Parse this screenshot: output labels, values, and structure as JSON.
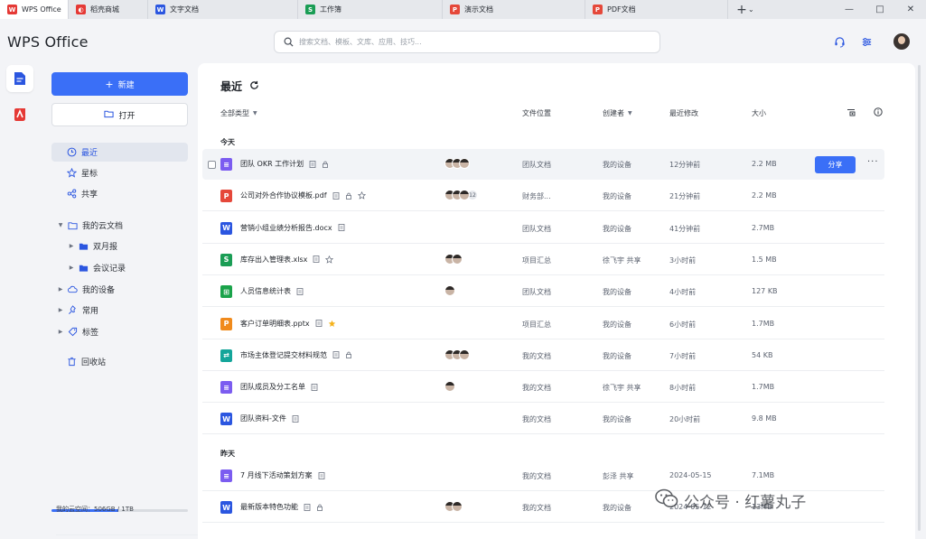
{
  "tabs": [
    {
      "label": "WPS Office",
      "icon": "wps-logo-icon",
      "color": "#e53935",
      "glyph": "W",
      "active": true,
      "width": 76
    },
    {
      "label": "稻壳商城",
      "icon": "docer-icon",
      "color": "#e53935",
      "glyph": "◐",
      "active": false,
      "width": 88
    },
    {
      "label": "文字文档",
      "icon": "writer-icon",
      "color": "#2b56e0",
      "glyph": "W",
      "active": false,
      "width": 166
    },
    {
      "label": "工作簿",
      "icon": "spreadsheet-icon",
      "color": "#1a9d55",
      "glyph": "S",
      "active": false,
      "width": 160
    },
    {
      "label": "演示文档",
      "icon": "presentation-icon",
      "color": "#e5483a",
      "glyph": "P",
      "active": false,
      "width": 158
    },
    {
      "label": "PDF文档",
      "icon": "pdf-icon",
      "color": "#e5483a",
      "glyph": "P",
      "active": false,
      "width": 158
    }
  ],
  "header": {
    "brand": "WPS Office",
    "search_placeholder": "搜索文档、模板、文库、应用、技巧..."
  },
  "sidebar": {
    "new_label": "新建",
    "open_label": "打开",
    "nav": [
      {
        "label": "最近",
        "icon": "clock-icon",
        "active": true,
        "indent": 0,
        "caret": ""
      },
      {
        "label": "星标",
        "icon": "star-icon",
        "active": false,
        "indent": 0,
        "caret": ""
      },
      {
        "label": "共享",
        "icon": "share-icon",
        "active": false,
        "indent": 0,
        "caret": ""
      },
      {
        "label": "我的云文档",
        "icon": "folder-outline-icon",
        "active": false,
        "indent": 0,
        "caret": "down"
      },
      {
        "label": "双月报",
        "icon": "folder-icon",
        "active": false,
        "indent": 1,
        "caret": "right"
      },
      {
        "label": "会议记录",
        "icon": "folder-icon",
        "active": false,
        "indent": 1,
        "caret": "right"
      },
      {
        "label": "我的设备",
        "icon": "cloud-icon",
        "active": false,
        "indent": 0,
        "caret": "right"
      },
      {
        "label": "常用",
        "icon": "pin-icon",
        "active": false,
        "indent": 0,
        "caret": "right"
      },
      {
        "label": "标签",
        "icon": "tag-icon",
        "active": false,
        "indent": 0,
        "caret": "right"
      },
      {
        "label": "回收站",
        "icon": "trash-icon",
        "active": false,
        "indent": 0,
        "caret": ""
      }
    ],
    "storage_label": "我的云空间：506GB / 1TB",
    "storage_upgrade": "查看",
    "storage_fraction": 0.49
  },
  "main": {
    "title": "最近",
    "columns": {
      "type": "全部类型",
      "location": "文件位置",
      "creator": "创建者",
      "modified": "最近修改",
      "size": "大小"
    },
    "groups": [
      {
        "label": "今天",
        "files": [
          {
            "name": "团队 OKR 工作计划",
            "type": "form",
            "collab": 3,
            "more": "",
            "star": false,
            "starred": false,
            "location": "团队文档",
            "creator": "我的设备",
            "modified": "12分钟前",
            "size": "2.2 MB",
            "hover": true
          },
          {
            "name": "公司对外合作协议模板.pdf",
            "type": "pdf",
            "collab": 3,
            "more": "12",
            "star": true,
            "starred": false,
            "location": "财务部...",
            "creator": "我的设备",
            "modified": "21分钟前",
            "size": "2.2 MB",
            "hover": false
          },
          {
            "name": "营销小组业绩分析报告.docx",
            "type": "word",
            "collab": 0,
            "more": "",
            "star": false,
            "starred": false,
            "location": "团队文档",
            "creator": "我的设备",
            "modified": "41分钟前",
            "size": "2.7MB",
            "hover": false
          },
          {
            "name": "库存出入管理表.xlsx",
            "type": "sheet",
            "collab": 2,
            "more": "",
            "star": true,
            "starred": false,
            "location": "项目汇总",
            "creator": "徐飞宇 共享",
            "modified": "3小时前",
            "size": "1.5 MB",
            "hover": false
          },
          {
            "name": "人员信息统计表",
            "type": "table",
            "collab": 1,
            "more": "",
            "star": false,
            "starred": false,
            "location": "团队文档",
            "creator": "我的设备",
            "modified": "4小时前",
            "size": "127 KB",
            "hover": false
          },
          {
            "name": "客户订单明细表.pptx",
            "type": "ppt",
            "collab": 0,
            "more": "",
            "star": true,
            "starred": true,
            "location": "项目汇总",
            "creator": "我的设备",
            "modified": "6小时前",
            "size": "1.7MB",
            "hover": false
          },
          {
            "name": "市场主体登记提交材料规范",
            "type": "flow",
            "collab": 3,
            "more": "",
            "star": false,
            "starred": false,
            "location": "我的文档",
            "creator": "我的设备",
            "modified": "7小时前",
            "size": "54 KB",
            "hover": false
          },
          {
            "name": "团队成员及分工名单",
            "type": "form",
            "collab": 1,
            "more": "",
            "star": false,
            "starred": false,
            "location": "我的文档",
            "creator": "徐飞宇 共享",
            "modified": "8小时前",
            "size": "1.7MB",
            "hover": false
          },
          {
            "name": "团队资料-文件",
            "type": "word",
            "collab": 0,
            "more": "",
            "star": false,
            "starred": false,
            "location": "我的文档",
            "creator": "我的设备",
            "modified": "20小时前",
            "size": "9.8 MB",
            "hover": false
          }
        ]
      },
      {
        "label": "昨天",
        "files": [
          {
            "name": "7 月线下活动策划方案",
            "type": "form",
            "collab": 0,
            "more": "",
            "star": false,
            "starred": false,
            "location": "我的文档",
            "creator": "彭泽 共享",
            "modified": "2024-05-15",
            "size": "7.1MB",
            "hover": false
          },
          {
            "name": "最新版本特色功能",
            "type": "word",
            "collab": 2,
            "more": "",
            "star": false,
            "starred": false,
            "location": "我的文档",
            "creator": "我的设备",
            "modified": "2024-05-12",
            "size": "13MB",
            "hover": false
          }
        ]
      }
    ],
    "share_label": "分享"
  },
  "watermark": "公众号 · 红薯丸子",
  "colors": {
    "accent": "#3a6ff7",
    "word": "#2b56e0",
    "sheet": "#1a9d55",
    "ppt": "#f08a1c",
    "pdf": "#e5483a",
    "form": "#7b5cf0",
    "table": "#1aa34a",
    "flow": "#14a59a"
  }
}
